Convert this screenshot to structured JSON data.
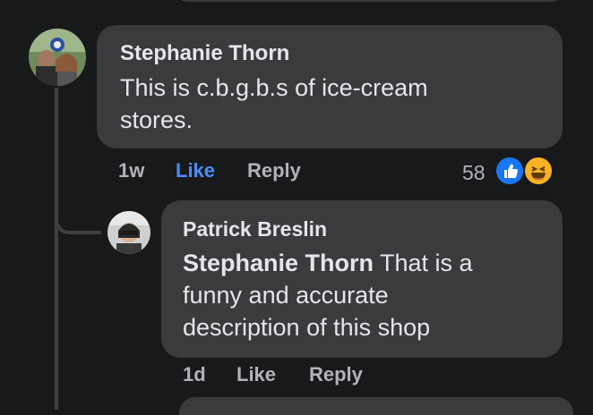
{
  "comments": [
    {
      "author": "Stephanie Thorn",
      "text_line1": "This is c.b.g.b.s of ice-cream",
      "text_line2": "stores.",
      "time": "1w",
      "like_label": "Like",
      "reply_label": "Reply",
      "reaction_count": "58",
      "reactions": [
        "like-icon",
        "haha-icon"
      ]
    }
  ],
  "replies": [
    {
      "author": "Patrick Breslin",
      "mention": "Stephanie Thorn",
      "text_line1_rest": " That is a",
      "text_line2": "funny and accurate",
      "text_line3": "description of this shop",
      "time": "1d",
      "like_label": "Like",
      "reply_label": "Reply"
    }
  ],
  "colors": {
    "background": "#18191a",
    "bubble": "#3a3b3c",
    "like_active": "#4b8df8",
    "like_reaction": "#1877f2",
    "haha_reaction": "#f7b125"
  }
}
